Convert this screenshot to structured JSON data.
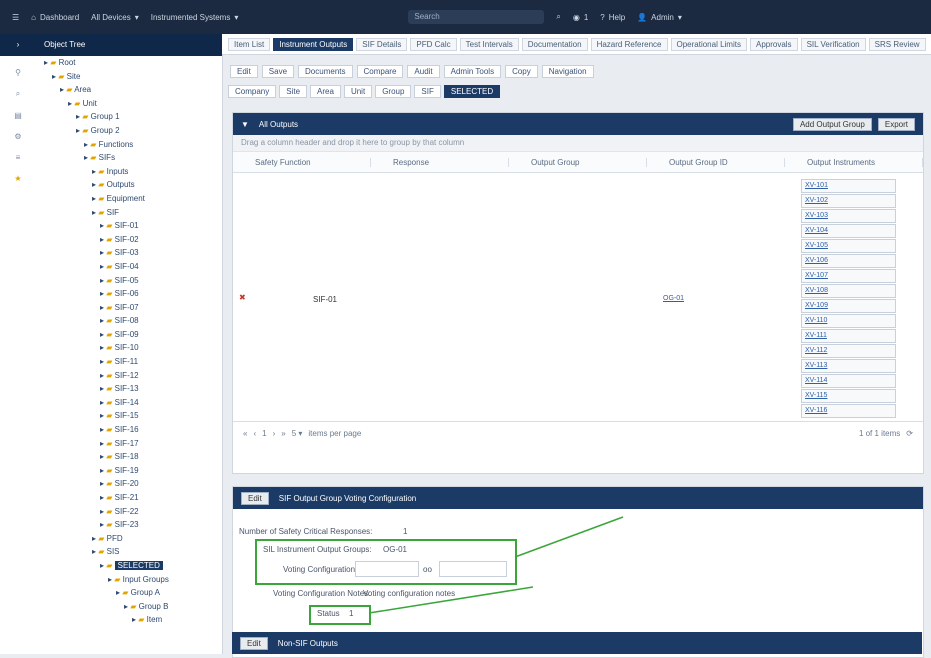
{
  "topbar": {
    "home_label": "Dashboard",
    "nav1": "All Devices",
    "nav2": "Instrumented Systems",
    "search_placeholder": "Search",
    "notifications": "1",
    "help": "Help",
    "user": "Admin"
  },
  "tree": {
    "header": "Object Tree",
    "rows": [
      {
        "label": "Root",
        "indent": 1
      },
      {
        "label": "Site",
        "indent": 2
      },
      {
        "label": "Area",
        "indent": 3
      },
      {
        "label": "Unit",
        "indent": 4
      },
      {
        "label": "Group 1",
        "indent": 5
      },
      {
        "label": "Group 2",
        "indent": 5
      },
      {
        "label": "Functions",
        "indent": 6
      },
      {
        "label": "SIFs",
        "indent": 6
      },
      {
        "label": "Inputs",
        "indent": 7
      },
      {
        "label": "Outputs",
        "indent": 7
      },
      {
        "label": "Equipment",
        "indent": 7
      },
      {
        "label": "SIF",
        "indent": 7
      },
      {
        "label": "SIF-01",
        "indent": 8
      },
      {
        "label": "SIF-02",
        "indent": 8
      },
      {
        "label": "SIF-03",
        "indent": 8
      },
      {
        "label": "SIF-04",
        "indent": 8
      },
      {
        "label": "SIF-05",
        "indent": 8
      },
      {
        "label": "SIF-06",
        "indent": 8
      },
      {
        "label": "SIF-07",
        "indent": 8
      },
      {
        "label": "SIF-08",
        "indent": 8
      },
      {
        "label": "SIF-09",
        "indent": 8
      },
      {
        "label": "SIF-10",
        "indent": 8
      },
      {
        "label": "SIF-11",
        "indent": 8
      },
      {
        "label": "SIF-12",
        "indent": 8
      },
      {
        "label": "SIF-13",
        "indent": 8
      },
      {
        "label": "SIF-14",
        "indent": 8
      },
      {
        "label": "SIF-15",
        "indent": 8
      },
      {
        "label": "SIF-16",
        "indent": 8
      },
      {
        "label": "SIF-17",
        "indent": 8
      },
      {
        "label": "SIF-18",
        "indent": 8
      },
      {
        "label": "SIF-19",
        "indent": 8
      },
      {
        "label": "SIF-20",
        "indent": 8
      },
      {
        "label": "SIF-21",
        "indent": 8
      },
      {
        "label": "SIF-22",
        "indent": 8
      },
      {
        "label": "SIF-23",
        "indent": 8
      },
      {
        "label": "PFD",
        "indent": 7
      },
      {
        "label": "SIS",
        "indent": 7
      },
      {
        "label": "SELECTED",
        "indent": 8,
        "selected": true
      },
      {
        "label": "Input Groups",
        "indent": 9
      },
      {
        "label": "Group A",
        "indent": 10
      },
      {
        "label": "Group B",
        "indent": 11
      },
      {
        "label": "Item",
        "indent": 12
      }
    ]
  },
  "tabs": [
    "Item List",
    "Instrument Outputs",
    "SIF Details",
    "PFD Calc",
    "Test Intervals",
    "Documentation",
    "Hazard Reference",
    "Operational Limits",
    "Approvals",
    "SIL Verification",
    "SRS Review"
  ],
  "toolbar": [
    "Edit",
    "Save",
    "Documents",
    "Compare",
    "Audit",
    "Admin Tools",
    "Copy",
    "Navigation"
  ],
  "breadcrumbs": [
    "Company",
    "Site",
    "Area",
    "Unit",
    "Group",
    "SIF",
    "SELECTED"
  ],
  "outputs_panel": {
    "title": "All Outputs",
    "btn1": "Add Output Group",
    "btn2": "Export",
    "drag_hint": "Drag a column header and drop it here to group by that column",
    "columns": [
      "Safety Function",
      "Response",
      "Output Group",
      "Output Group ID",
      "Output Instruments"
    ],
    "row_value": "SIF-01",
    "group_link": "OG-01",
    "instruments": [
      "XV-101",
      "XV-102",
      "XV-103",
      "XV-104",
      "XV-105",
      "XV-106",
      "XV-107",
      "XV-108",
      "XV-109",
      "XV-110",
      "XV-111",
      "XV-112",
      "XV-113",
      "XV-114",
      "XV-115",
      "XV-116"
    ],
    "pager_text": "items per page",
    "total_text": "1 of 1 items"
  },
  "config_panel": {
    "title": "SIF Output Group Voting Configuration",
    "btn": "Edit",
    "num_responses_label": "Number of Safety Critical Responses:",
    "num_responses_value": "1",
    "group_label": "SIL Instrument Output Groups:",
    "group_value": "OG-01",
    "voting_label": "Voting Configuration",
    "voting_sep": "oo",
    "voting_notes_label": "Voting Configuration Notes:",
    "voting_notes_value": "Voting configuration notes",
    "status_label": "Status",
    "status_value": "1"
  },
  "second_panel": {
    "title": "Non-SIF Outputs",
    "btn": "Edit"
  }
}
